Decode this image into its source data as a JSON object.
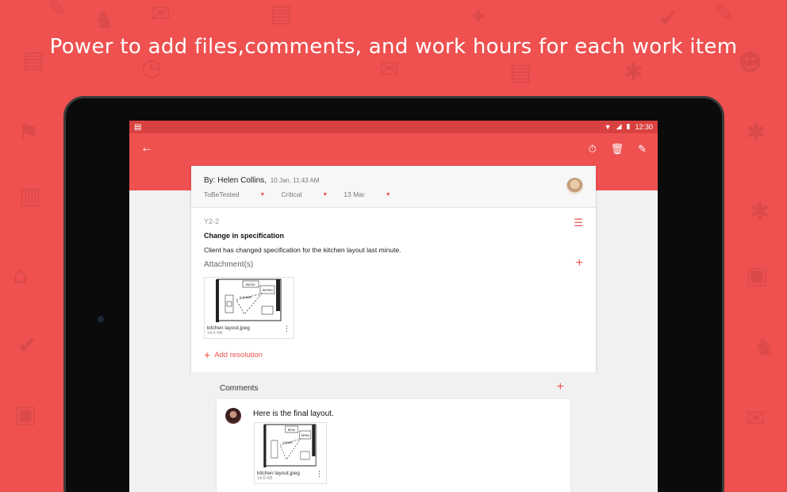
{
  "headline": "Power to add files,comments, and work hours for each work item",
  "status_bar": {
    "time": "12:30"
  },
  "toolbar": {
    "back_icon": "arrow-left-icon",
    "timer_icon": "stopwatch-icon",
    "delete_icon": "trash-icon",
    "edit_icon": "pencil-icon"
  },
  "item": {
    "by_label": "By: Helen Collins,",
    "timestamp": "10 Jan, 11:43 AM",
    "status": "ToBeTested",
    "priority": "Critical",
    "due": "13 Mar",
    "code": "Y2-2",
    "title": "Change in specification",
    "description": "Client has changed specification for the kitchen layout last minute.",
    "attachments_label": "Attachment(s)",
    "attachment": {
      "name": "kitchen layout.jpeg",
      "size": "14.6 KB"
    },
    "add_resolution": "Add resolution"
  },
  "comments": {
    "label": "Comments",
    "items": [
      {
        "text": "Here is the final layout.",
        "attachment": {
          "name": "kitchen layout.jpeg",
          "size": "14.6 KB"
        }
      }
    ]
  },
  "colors": {
    "accent": "#ee5150",
    "status_bar": "#d94040"
  }
}
